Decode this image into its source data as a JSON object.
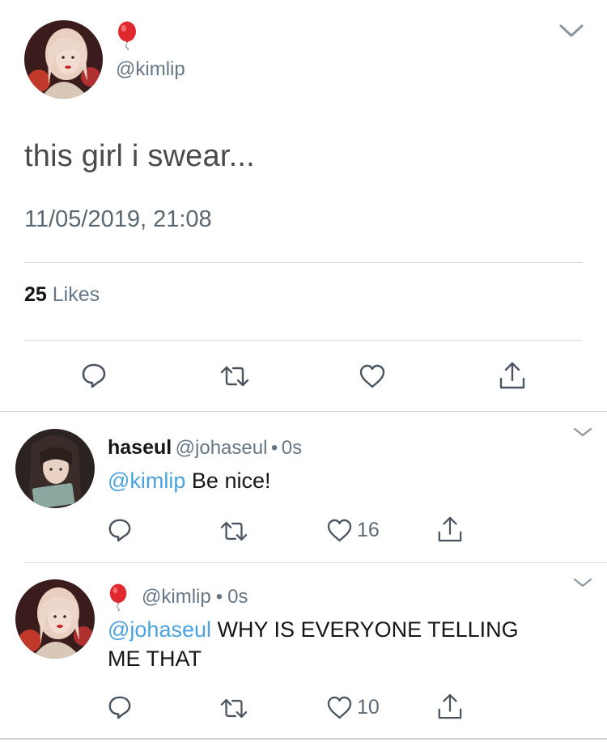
{
  "main_tweet": {
    "emoji": "🎈",
    "handle": "@kimlip",
    "text": "this girl i swear...",
    "timestamp": "11/05/2019, 21:08",
    "likes_count": "25",
    "likes_label": "Likes"
  },
  "reply1": {
    "name": "haseul",
    "handle": "@johaseul",
    "sep": "•",
    "time": "0s",
    "mention": "@kimlip",
    "text": " Be nice!",
    "likes": "16"
  },
  "reply2": {
    "emoji": "🎈",
    "handle": "@kimlip",
    "sep": "•",
    "time": "0s",
    "mention": "@johaseul",
    "text_line1": " WHY IS EVERYONE TELLING",
    "text_line2": "ME THAT",
    "likes": "10"
  },
  "icons": [
    "reply-icon",
    "retweet-icon",
    "like-icon",
    "share-icon",
    "chevron-down-icon",
    "balloon-emoji"
  ],
  "colors": {
    "link": "#4aa3df",
    "muted": "#657786",
    "divider": "#d9dde0"
  }
}
